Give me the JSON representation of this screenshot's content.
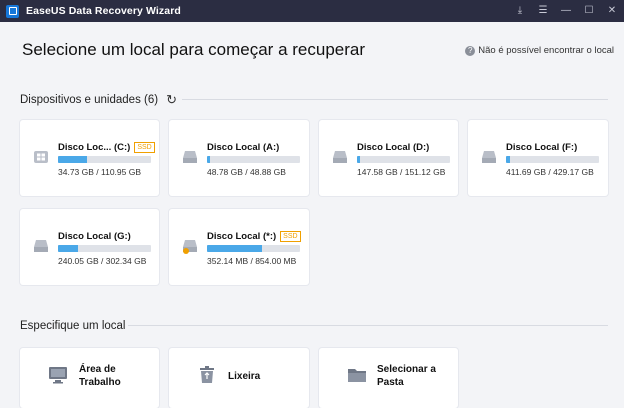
{
  "window": {
    "title": "EaseUS Data Recovery Wizard"
  },
  "header": {
    "title": "Selecione um local para começar a recuperar",
    "help_link": "Não é possível encontrar o local"
  },
  "devices": {
    "section_label": "Dispositivos e unidades (6)",
    "items": [
      {
        "name": "Disco Loc... (C:)",
        "badge": "SSD",
        "size": "34.73 GB / 110.95 GB",
        "usage": 0.31,
        "icon": "windows-drive-icon"
      },
      {
        "name": "Disco Local (A:)",
        "badge": "",
        "size": "48.78 GB / 48.88 GB",
        "usage": 0.03,
        "icon": "drive-icon"
      },
      {
        "name": "Disco Local (D:)",
        "badge": "",
        "size": "147.58 GB / 151.12 GB",
        "usage": 0.03,
        "icon": "drive-icon"
      },
      {
        "name": "Disco Local (F:)",
        "badge": "",
        "size": "411.69 GB / 429.17 GB",
        "usage": 0.04,
        "icon": "drive-icon"
      },
      {
        "name": "Disco Local (G:)",
        "badge": "",
        "size": "240.05 GB / 302.34 GB",
        "usage": 0.21,
        "icon": "drive-icon"
      },
      {
        "name": "Disco Local (*:)",
        "badge": "SSD",
        "size": "352.14 MB / 854.00 MB",
        "usage": 0.59,
        "icon": "drive-warning-icon"
      }
    ]
  },
  "locations": {
    "section_label": "Especifique um local",
    "items": [
      {
        "line1": "Área de",
        "line2": "Trabalho",
        "icon": "desktop-icon"
      },
      {
        "line1": "Lixeira",
        "line2": "",
        "icon": "recycle-bin-icon"
      },
      {
        "line1": "Selecionar a",
        "line2": "Pasta",
        "icon": "folder-icon"
      }
    ]
  },
  "colors": {
    "titlebar": "#2b2d42",
    "accent": "#4aa8e8",
    "ssd_badge": "#f0a000"
  }
}
